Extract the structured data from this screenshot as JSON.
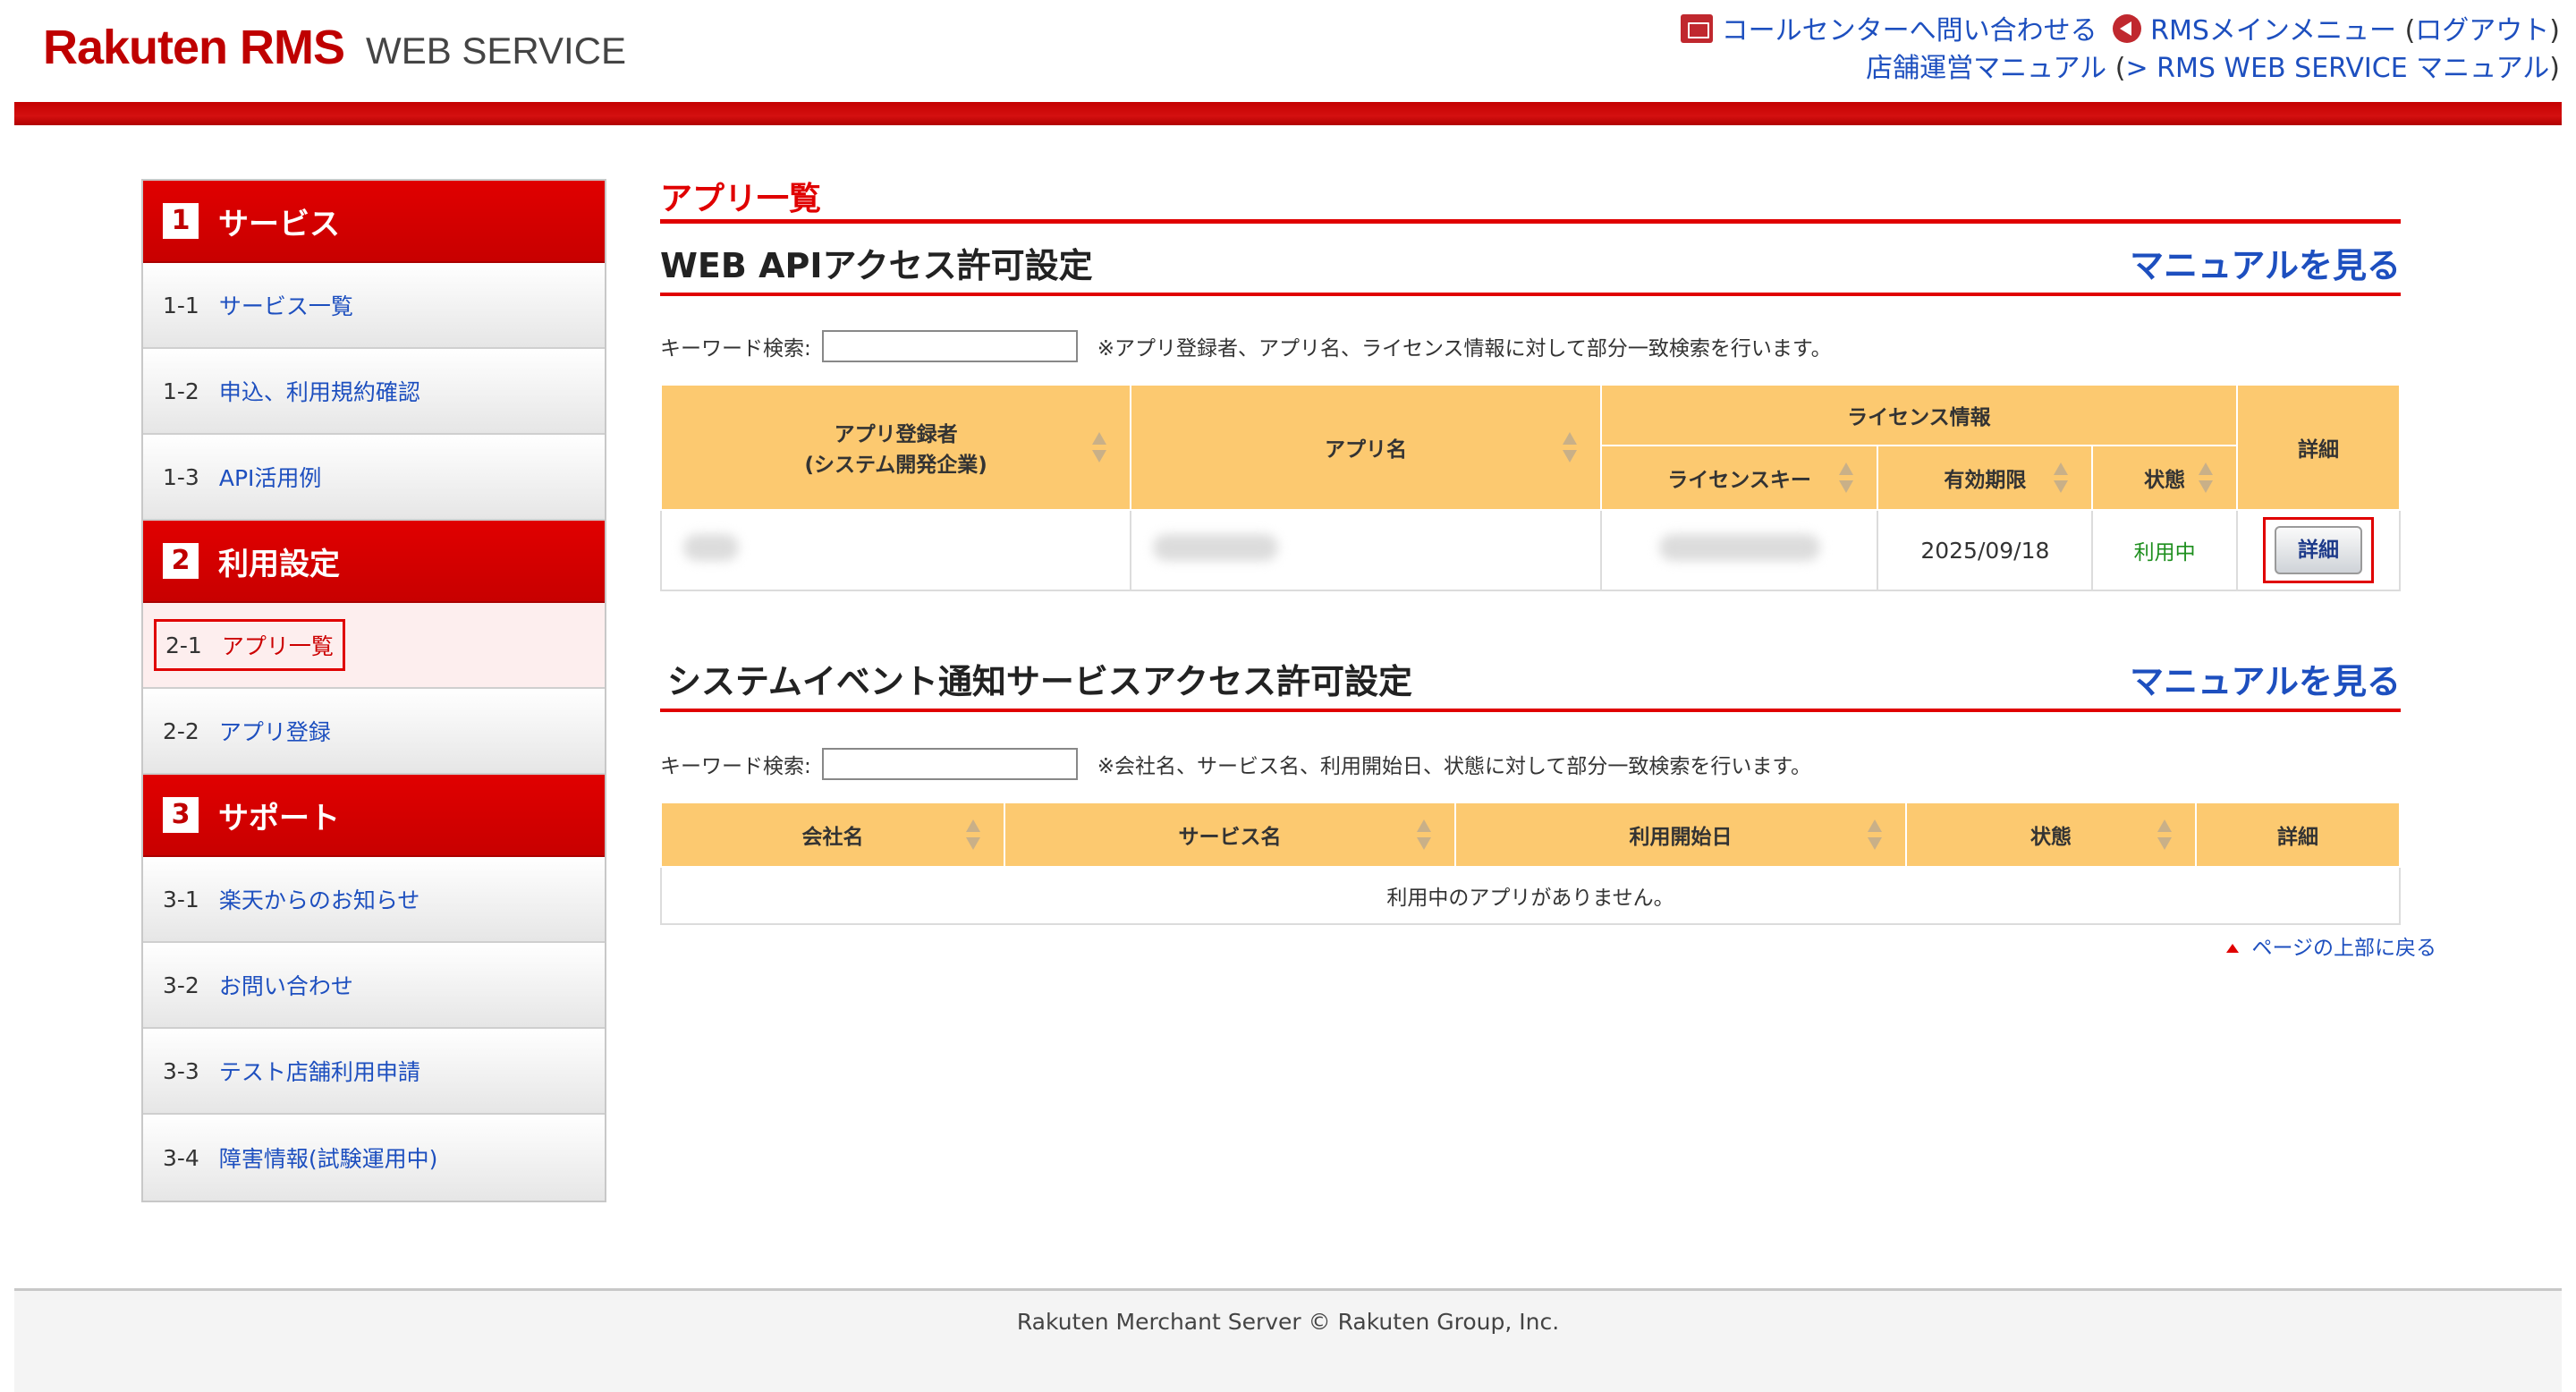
{
  "header": {
    "logo_main": "Rakuten RMS",
    "logo_sub": "WEB SERVICE",
    "call_center": "コールセンターへ問い合わせる",
    "rms_menu": "RMSメインメニュー",
    "logout_open": "(",
    "logout": "ログアウト",
    "logout_close": ")",
    "manual": "店舗運営マニュアル",
    "ws_manual_open": "(",
    "ws_manual": "> RMS WEB SERVICE マニュアル",
    "ws_manual_close": ")",
    "accent_color": "#bf0000"
  },
  "sidebar": {
    "sections": [
      {
        "num": "1",
        "title": "サービス"
      },
      {
        "num": "2",
        "title": "利用設定"
      },
      {
        "num": "3",
        "title": "サポート"
      }
    ],
    "items": [
      {
        "id": "1-1",
        "label": "サービス一覧"
      },
      {
        "id": "1-2",
        "label": "申込、利用規約確認"
      },
      {
        "id": "1-3",
        "label": "API活用例"
      },
      {
        "id": "2-1",
        "label": "アプリ一覧"
      },
      {
        "id": "2-2",
        "label": "アプリ登録"
      },
      {
        "id": "3-1",
        "label": "楽天からのお知らせ"
      },
      {
        "id": "3-2",
        "label": "お問い合わせ"
      },
      {
        "id": "3-3",
        "label": "テスト店舗利用申請"
      },
      {
        "id": "3-4",
        "label": "障害情報(試験運用中)"
      }
    ]
  },
  "main": {
    "page_title": "アプリ一覧",
    "webapi": {
      "title": "WEB APIアクセス許可設定",
      "manual_link": "マニュアルを見る",
      "search_label": "キーワード検索:",
      "search_value": "",
      "search_note": "※アプリ登録者、アプリ名、ライセンス情報に対して部分一致検索を行います。",
      "columns": {
        "registrant_line1": "アプリ登録者",
        "registrant_line2": "(システム開発企業)",
        "app_name": "アプリ名",
        "license_info": "ライセンス情報",
        "license_key": "ライセンスキー",
        "expiry": "有効期限",
        "status": "状態",
        "detail": "詳細"
      },
      "rows": [
        {
          "expiry": "2025/09/18",
          "status": "利用中",
          "detail_button": "詳細"
        }
      ]
    },
    "sysevent": {
      "title": "システムイベント通知サービスアクセス許可設定",
      "manual_link": "マニュアルを見る",
      "search_label": "キーワード検索:",
      "search_value": "",
      "search_note": "※会社名、サービス名、利用開始日、状態に対して部分一致検索を行います。",
      "columns": {
        "company": "会社名",
        "service": "サービス名",
        "start_date": "利用開始日",
        "status": "状態",
        "detail": "詳細"
      },
      "empty_message": "利用中のアプリがありません。"
    },
    "page_top": "ページの上部に戻る"
  },
  "footer": {
    "copyright": "Rakuten Merchant Server © Rakuten Group, Inc."
  }
}
